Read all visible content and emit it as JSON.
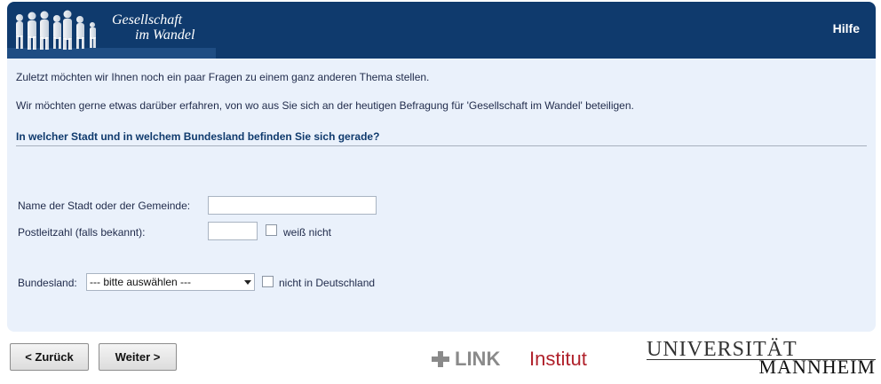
{
  "header": {
    "logo_line1": "Gesellschaft",
    "logo_line2": "im Wandel",
    "help_label": "Hilfe",
    "background_color": "#0f3a6d"
  },
  "intro": {
    "line1": "Zuletzt möchten wir Ihnen noch ein paar Fragen zu einem ganz anderen Thema stellen.",
    "line2": "Wir möchten gerne etwas darüber erfahren, von wo aus Sie sich an der heutigen Befragung für 'Gesellschaft im Wandel' beteiligen."
  },
  "question": "In welcher Stadt und in welchem Bundesland befinden Sie sich gerade?",
  "form": {
    "city_label": "Name der Stadt oder der Gemeinde:",
    "city_value": "",
    "zip_label": "Postleitzahl (falls bekannt):",
    "zip_value": "",
    "zip_unknown_label": "weiß nicht",
    "state_label": "Bundesland:",
    "state_selected": "--- bitte auswählen ---",
    "not_germany_label": "nicht in Deutschland"
  },
  "nav": {
    "back_label": "< Zurück",
    "next_label": "Weiter >"
  },
  "logos": {
    "link_text": "LINK",
    "link_suffix": "Institut",
    "uni_top": "UNIVERSITÄT",
    "uni_bottom": "MANNHEIM"
  },
  "panel_color": "#eaf1fb"
}
